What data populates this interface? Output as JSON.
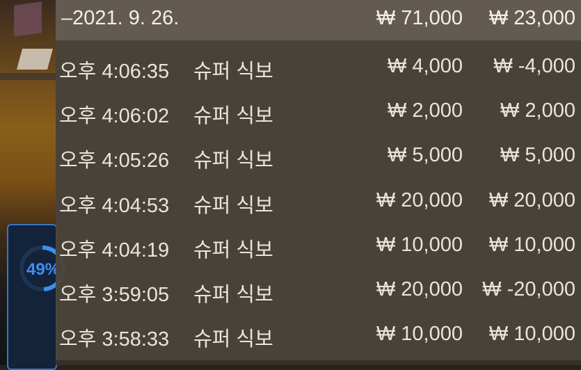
{
  "background": {
    "gauge_text": "49%"
  },
  "header": {
    "date": "–2021. 9. 26.",
    "total_amount": "₩ 71,000",
    "total_balance": "₩ 23,000"
  },
  "transactions": [
    {
      "time": "오후 4:06:35",
      "merchant": "슈퍼 식보",
      "amount": "₩ 4,000",
      "balance": "₩ -4,000"
    },
    {
      "time": "오후 4:06:02",
      "merchant": "슈퍼 식보",
      "amount": "₩ 2,000",
      "balance": "₩ 2,000"
    },
    {
      "time": "오후 4:05:26",
      "merchant": "슈퍼 식보",
      "amount": "₩ 5,000",
      "balance": "₩ 5,000"
    },
    {
      "time": "오후 4:04:53",
      "merchant": "슈퍼 식보",
      "amount": "₩ 20,000",
      "balance": "₩ 20,000"
    },
    {
      "time": "오후 4:04:19",
      "merchant": "슈퍼 식보",
      "amount": "₩ 10,000",
      "balance": "₩ 10,000"
    },
    {
      "time": "오후 3:59:05",
      "merchant": "슈퍼 식보",
      "amount": "₩ 20,000",
      "balance": "₩ -20,000"
    },
    {
      "time": "오후 3:58:33",
      "merchant": "슈퍼 식보",
      "amount": "₩ 10,000",
      "balance": "₩ 10,000"
    }
  ]
}
